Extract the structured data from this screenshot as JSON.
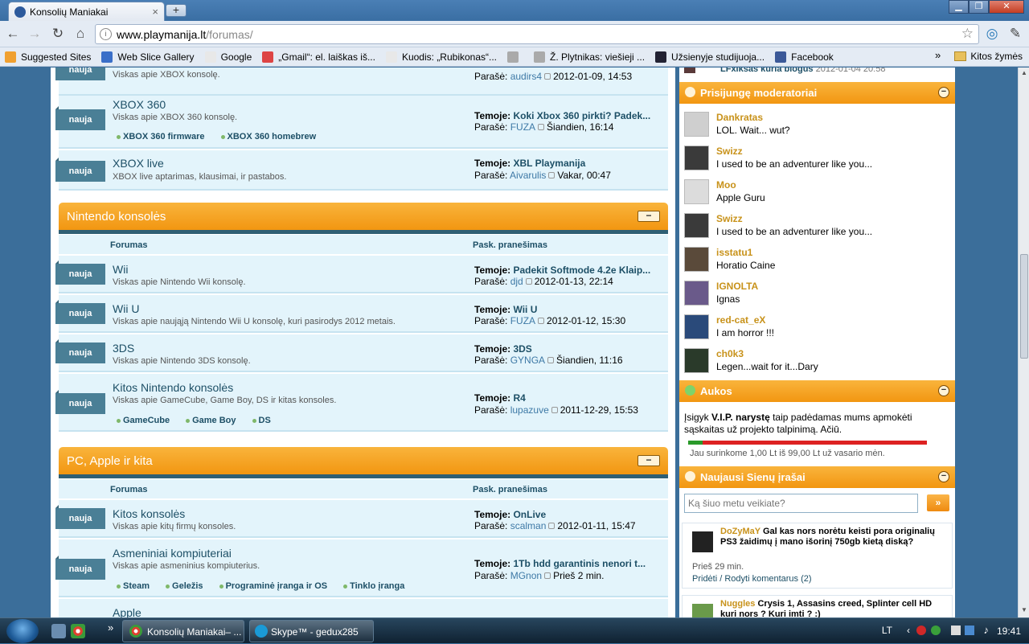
{
  "browser": {
    "tab_title": "Konsolių Maniakai",
    "tab_close": "×",
    "newtab": "+",
    "url_host": "www.playmanija.lt",
    "url_path": "/forumas/",
    "win_min": "▁",
    "win_max": "❐",
    "win_close": "✕"
  },
  "bookmarks": [
    {
      "label": "Suggested Sites",
      "color": "#f0a030"
    },
    {
      "label": "Web Slice Gallery",
      "color": "#3a6fc8"
    },
    {
      "label": "Google",
      "color": "#e8e8e8"
    },
    {
      "label": "„Gmail“: el. laiškas iš...",
      "color": "#d44"
    },
    {
      "label": "Kuodis: „Rubikonas“...",
      "color": "#e8e8e8"
    },
    {
      "label": "",
      "color": "#aaa"
    },
    {
      "label": "Ž. Plytnikas: viešieji ...",
      "color": "#aaa"
    },
    {
      "label": "Užsienyje studijuoja...",
      "color": "#223"
    },
    {
      "label": "Facebook",
      "color": "#3b5998"
    }
  ],
  "bookmarks_more": "»",
  "bookmarks_other": "Kitos žymės",
  "forum": {
    "xbox": {
      "top_desc": "Viskas apie XBOX konsolę.",
      "top_author_prefix": "Parašė:",
      "top_author": "audirs4",
      "top_date": "2012-01-09, 14:53",
      "x360_title": "XBOX 360",
      "x360_desc": "Viskas apie XBOX 360 konsolę.",
      "x360_subs": [
        "XBOX 360 firmware",
        "XBOX 360 homebrew"
      ],
      "x360_topic_label": "Temoje:",
      "x360_topic": "Koki Xbox 360 pirkti? Padek...",
      "x360_author_label": "Parašė:",
      "x360_author": "FUZA",
      "x360_date": "Šiandien, 16:14",
      "live_title": "XBOX live",
      "live_desc": "XBOX live aptarimas, klausimai, ir pastabos.",
      "live_topic": "XBL Playmanija",
      "live_author": "Aivarulis",
      "live_date": "Vakar, 00:47"
    },
    "badge": "nauja",
    "nintendo": {
      "header": "Nintendo konsolės",
      "minus": "−",
      "col_forum": "Forumas",
      "col_last": "Pask. pranešimas",
      "wii_title": "Wii",
      "wii_desc": "Viskas apie Nintendo Wii konsolę.",
      "wii_topic": "Padekit Softmode 4.2e Klaip...",
      "wii_author": "djd",
      "wii_date": "2012-01-13, 22:14",
      "wiiu_title": "Wii U",
      "wiiu_desc": "Viskas apie naująją Nintendo Wii U konsolę, kuri pasirodys 2012 metais.",
      "wiiu_topic": "Wii U",
      "wiiu_author": "FUZA",
      "wiiu_date": "2012-01-12, 15:30",
      "ds_title": "3DS",
      "ds_desc": "Viskas apie Nintendo 3DS konsolę.",
      "ds_topic": "3DS",
      "ds_author": "GYNGA",
      "ds_date": "Šiandien, 11:16",
      "other_title": "Kitos Nintendo konsolės",
      "other_desc": "Viskas apie GameCube, Game Boy, DS ir kitas konsoles.",
      "other_subs": [
        "GameCube",
        "Game Boy",
        "DS"
      ],
      "other_topic": "R4",
      "other_author": "lupazuve",
      "other_date": "2011-12-29, 15:53"
    },
    "pc": {
      "header": "PC, Apple ir kita",
      "col_forum": "Forumas",
      "col_last": "Pask. pranešimas",
      "other_title": "Kitos konsolės",
      "other_desc": "Viskas apie kitų firmų konsoles.",
      "other_topic": "OnLive",
      "other_author": "scalman",
      "other_date": "2012-01-11, 15:47",
      "comp_title": "Asmeniniai kompiuteriai",
      "comp_desc": "Viskas apie asmeninius kompiuterius.",
      "comp_subs": [
        "Steam",
        "Geležis",
        "Programinė įranga ir OS",
        "Tinklo įranga"
      ],
      "comp_topic": "1Tb hdd garantinis nenori t...",
      "comp_author": "MGnon",
      "comp_date": "Prieš 2 min.",
      "apple_title": "Apple"
    }
  },
  "sidebar": {
    "top_snippet": "LFxiksas kuria blogus",
    "top_snippet_date": "2012-01-04 20:58",
    "mods_header": "Prisijungę moderatoriai",
    "mods": [
      {
        "name": "Dankratas",
        "text": "LOL. Wait... wut?",
        "avatar": "#cfcfcf"
      },
      {
        "name": "Swizz",
        "text": "I used to be an adventurer like you...",
        "avatar": "#3a3a3a"
      },
      {
        "name": "Moo",
        "text": "Apple Guru",
        "avatar": "#dcdcdc"
      },
      {
        "name": "Swizz",
        "text": "I used to be an adventurer like you...",
        "avatar": "#3a3a3a"
      },
      {
        "name": "isstatu1",
        "text": "Horatio Caine",
        "avatar": "#5a4a3a"
      },
      {
        "name": "IGNOLTA",
        "text": "Ignas",
        "avatar": "#6a5a8a"
      },
      {
        "name": "red-cat_eX",
        "text": "I am horror !!!",
        "avatar": "#2a4a7a"
      },
      {
        "name": "ch0k3",
        "text": "Legen...wait for it...Dary",
        "avatar": "#2a3a2a"
      }
    ],
    "aukos_header": "Aukos",
    "aukos_text_1": "Įsigyk ",
    "aukos_bold": "V.I.P. narystę",
    "aukos_text_2": " taip padėdamas mums apmokėti sąskaitas už projekto talpinimą. Ačiū.",
    "aukos_progress_fraction": 0.0101,
    "aukos_progress_text": "Jau surinkome 1,00 Lt iš 99,00 Lt už vasario mėn.",
    "wall_header": "Naujausi Sienų įrašai",
    "wall_placeholder": "Ką šiuo metu veikiate?",
    "wall_submit": "»",
    "wall_posts": [
      {
        "user": "DoZyMaY",
        "text": "Gal kas nors norėtu keisti pora originalių PS3 žaidimų į mano išorinį 750gb kietą diską?",
        "time": "Prieš 29 min.",
        "actions": "Pridėti / Rodyti komentarus (2)"
      },
      {
        "user": "Nuggles",
        "text": "Crysis 1, Assasins creed, Splinter cell HD kuri nors ? Kuri imti ? :)"
      }
    ]
  },
  "taskbar": {
    "tasks": [
      "Konsolių Maniakai– ...",
      "Skype™ - gedux285"
    ],
    "chevron": "»",
    "lang": "LT",
    "clock": "19:41"
  }
}
